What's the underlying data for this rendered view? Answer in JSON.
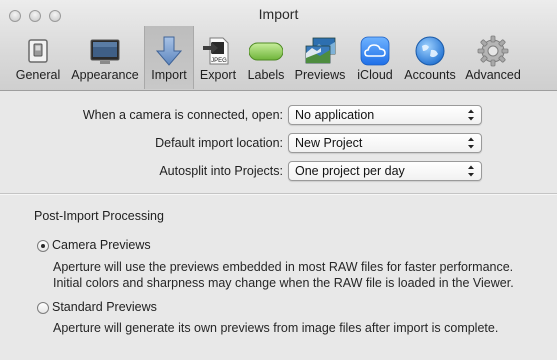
{
  "window": {
    "title": "Import"
  },
  "toolbar": {
    "tabs": [
      {
        "label": "General",
        "icon": "switch-icon",
        "active": false
      },
      {
        "label": "Appearance",
        "icon": "display-icon",
        "active": false
      },
      {
        "label": "Import",
        "icon": "import-arrow-icon",
        "active": true
      },
      {
        "label": "Export",
        "icon": "jpeg-export-icon",
        "active": false
      },
      {
        "label": "Labels",
        "icon": "label-icon",
        "active": false
      },
      {
        "label": "Previews",
        "icon": "previews-icon",
        "active": false
      },
      {
        "label": "iCloud",
        "icon": "icloud-icon",
        "active": false
      },
      {
        "label": "Accounts",
        "icon": "globe-icon",
        "active": false
      },
      {
        "label": "Advanced",
        "icon": "gear-icon",
        "active": false
      }
    ],
    "export_icon_text": "JPEG"
  },
  "settings": {
    "camera_connected": {
      "label": "When a camera is connected, open:",
      "value": "No application"
    },
    "import_location": {
      "label": "Default import location:",
      "value": "New Project"
    },
    "autosplit": {
      "label": "Autosplit into Projects:",
      "value": "One project per day"
    }
  },
  "post_import": {
    "title": "Post-Import Processing",
    "camera_previews": {
      "label": "Camera Previews",
      "selected": true,
      "description_line1": "Aperture will use the previews embedded in most RAW files for faster performance.",
      "description_line2": "Initial colors and sharpness may change when the RAW file is loaded in the Viewer."
    },
    "standard_previews": {
      "label": "Standard Previews",
      "selected": false,
      "description_line1": "Aperture will generate its own previews from image files after import is complete."
    }
  },
  "colors": {
    "toolbar_top": "#ececec",
    "toolbar_bottom": "#cfcfcf",
    "content_bg": "#e8e8e8",
    "active_tab": "#c3c3c3",
    "import_icon_blue": "#6f95c8",
    "labels_icon_green": "#7bc043",
    "icloud_blue": "#2f7ff0",
    "accounts_blue": "#2f86e0"
  }
}
